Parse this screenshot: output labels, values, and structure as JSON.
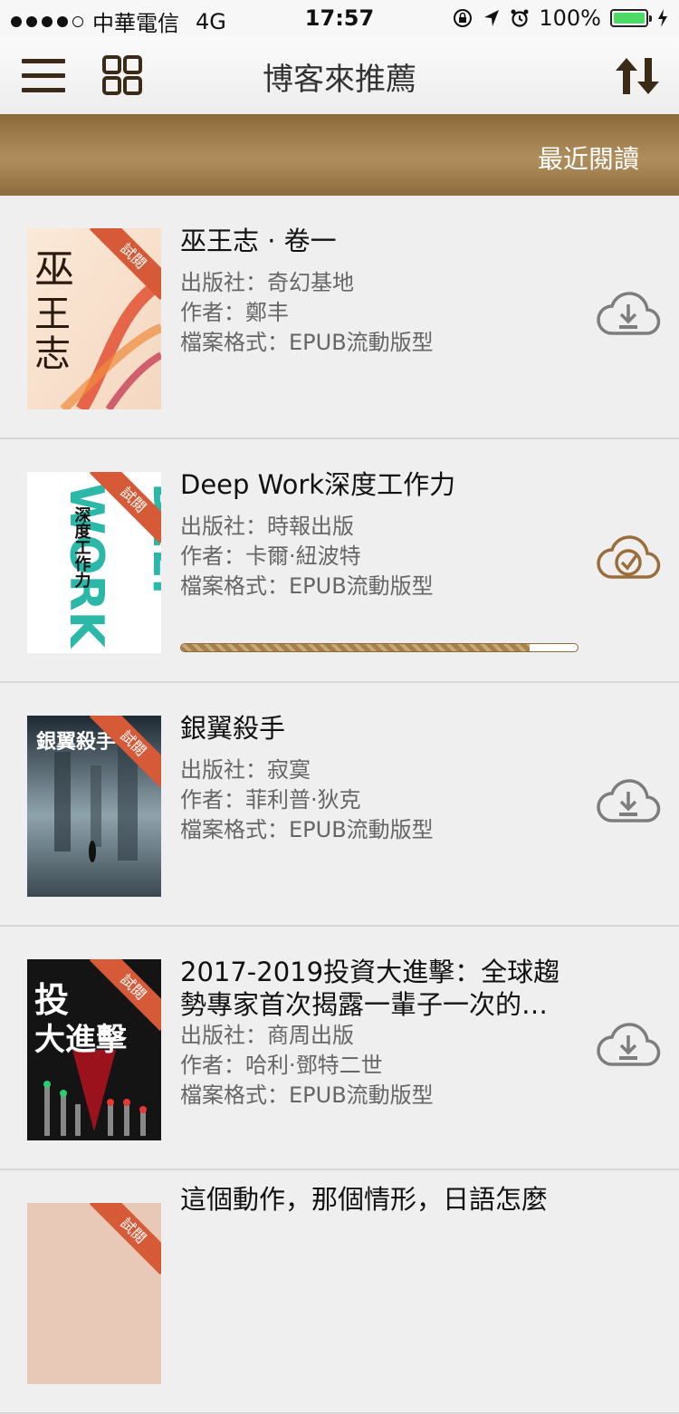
{
  "status_bar": {
    "carrier": "中華電信",
    "network": "4G",
    "time": "17:57",
    "battery": "100%"
  },
  "nav": {
    "title": "博客來推薦"
  },
  "banner": {
    "recent_label": "最近閱讀"
  },
  "books": [
    {
      "title": "巫王志 · 卷一",
      "publisher": "出版社：奇幻基地",
      "author": "作者：鄭丰",
      "format": "檔案格式：EPUB流動版型",
      "ribbon": "試閱",
      "cover_text": "巫王志",
      "download_state": "download"
    },
    {
      "title": "Deep Work深度工作力",
      "publisher": "出版社：時報出版",
      "author": "作者：卡爾·紐波特",
      "format": "檔案格式：EPUB流動版型",
      "ribbon": "試閱",
      "cover_text": "深度工作力",
      "download_state": "downloaded",
      "progress": 0.88
    },
    {
      "title": "銀翼殺手",
      "publisher": "出版社：寂寞",
      "author": "作者：菲利普·狄克",
      "format": "檔案格式：EPUB流動版型",
      "ribbon": "試閱",
      "cover_text": "銀翼殺手",
      "download_state": "download"
    },
    {
      "title": "2017-2019投資大進擊：全球趨勢專家首次揭露一輩子一次的…",
      "publisher": "出版社：商周出版",
      "author": "作者：哈利·鄧特二世",
      "format": "檔案格式：EPUB流動版型",
      "ribbon": "試閱",
      "cover_text": "投資大進擊",
      "download_state": "download"
    },
    {
      "title": "這個動作，那個情形，日語怎麼",
      "ribbon": "試閱"
    }
  ],
  "colors": {
    "brand_brown": "#8d6a3a",
    "ribbon": "#d65a37",
    "battery": "#4cd964"
  }
}
